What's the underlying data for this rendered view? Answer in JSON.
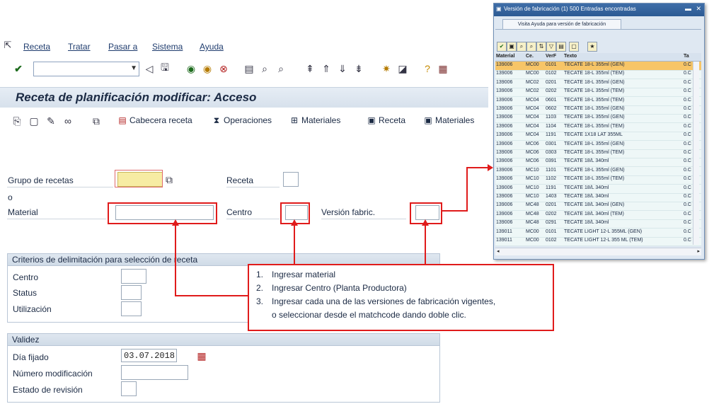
{
  "menu": [
    "Receta",
    "Tratar",
    "Pasar a",
    "Sistema",
    "Ayuda"
  ],
  "title": "Receta de planificación modificar: Acceso",
  "app_toolbar": {
    "cabecera": "Cabecera receta",
    "operaciones": "Operaciones",
    "materiales1": "Materiales",
    "receta": "Receta",
    "materiales2": "Materiales"
  },
  "form": {
    "grupo_label": "Grupo de recetas",
    "o_label": "o",
    "material_label": "Material",
    "receta_label": "Receta",
    "centro_label": "Centro",
    "version_label": "Versión fabric."
  },
  "criterios": {
    "header": "Criterios de delimitación para selección de receta",
    "centro": "Centro",
    "status": "Status",
    "utilizacion": "Utilización"
  },
  "validez": {
    "header": "Validez",
    "dia_label": "Día fijado",
    "dia_value": "03.07.2018",
    "num_mod": "Número modificación",
    "estado": "Estado de revisión"
  },
  "popup": {
    "title": "Versión de fabricación (1)  500 Entradas encontradas",
    "tab": "Visita Ayuda para versión de fabricación",
    "columns": [
      "Material",
      "Ce.",
      "VerF",
      "Texto",
      "Ta"
    ],
    "rows": [
      [
        "139006",
        "MC00",
        "0101",
        "TECATE 18-L 355ml (GEN)",
        "0.C"
      ],
      [
        "139006",
        "MC00",
        "0102",
        "TECATE 18-L 355ml (TEM)",
        "0.C"
      ],
      [
        "139006",
        "MC02",
        "0201",
        "TECATE 18-L 355ml (GEN)",
        "0.C"
      ],
      [
        "139006",
        "MC02",
        "0202",
        "TECATE 18-L 355ml (TEM)",
        "0.C"
      ],
      [
        "139006",
        "MC04",
        "0601",
        "TECATE 18-L 355ml (TEM)",
        "0.C"
      ],
      [
        "139006",
        "MC04",
        "0602",
        "TECATE 18-L 355ml (GEN)",
        "0.C"
      ],
      [
        "139006",
        "MC04",
        "1103",
        "TECATE 18-L 355ml (GEN)",
        "0.C"
      ],
      [
        "139006",
        "MC04",
        "1104",
        "TECATE 18-L 355ml (TEM)",
        "0.C"
      ],
      [
        "139006",
        "MC04",
        "1191",
        "TECATE 1X18 LAT 355ML",
        "0.C"
      ],
      [
        "139006",
        "MC06",
        "0301",
        "TECATE 18-L 355ml (GEN)",
        "0.C"
      ],
      [
        "139006",
        "MC06",
        "0303",
        "TECATE 18-L 355ml (TEM)",
        "0.C"
      ],
      [
        "139006",
        "MC06",
        "0391",
        "TECATE 18/L 340ml",
        "0.C"
      ],
      [
        "139006",
        "MC10",
        "1101",
        "TECATE 18-L 355ml (GEN)",
        "0.C"
      ],
      [
        "139006",
        "MC10",
        "1102",
        "TECATE 18-L 355ml (TEM)",
        "0.C"
      ],
      [
        "139006",
        "MC10",
        "1191",
        "TECATE 18/L 340ml",
        "0.C"
      ],
      [
        "139006",
        "MC10",
        "1403",
        "TECATE 18/L 340ml",
        "0.C"
      ],
      [
        "139006",
        "MC48",
        "0201",
        "TECATE 18/L 340ml (GEN)",
        "0.C"
      ],
      [
        "139006",
        "MC48",
        "0202",
        "TECATE 18/L 340ml (TEM)",
        "0.C"
      ],
      [
        "139006",
        "MC48",
        "0291",
        "TECATE 18/L 340ml",
        "0.C"
      ],
      [
        "139011",
        "MC00",
        "0101",
        "TECATE LIGHT 12-L 355ML (GEN)",
        "0.C"
      ],
      [
        "139011",
        "MC00",
        "0102",
        "TECATE LIGHT 12-L 355 ML (TEM)",
        "0.C"
      ]
    ]
  },
  "callout": [
    {
      "n": "1.",
      "text": "Ingresar material"
    },
    {
      "n": "2.",
      "text": "Ingresar Centro (Planta Productora)"
    },
    {
      "n": "3.",
      "text": "Ingresar cada una de las versiones de fabricación vigentes,"
    },
    {
      "n": "",
      "text": "o seleccionar desde el matchcode dando doble clic."
    }
  ],
  "colors": {
    "accent_red": "#e01b1b",
    "selected_row": "#f7c567",
    "popup_header": "#2c5a93"
  }
}
